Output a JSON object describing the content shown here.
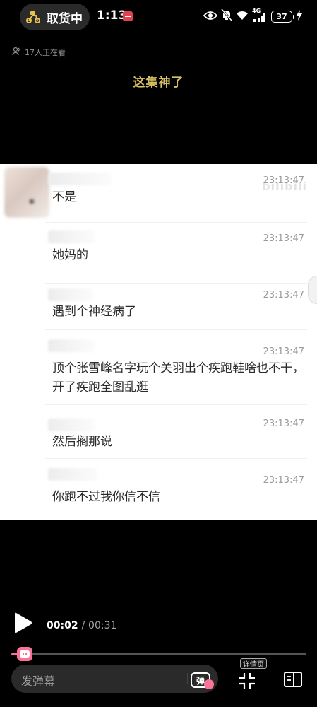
{
  "status_bar": {
    "pickup_label": "取货中",
    "time": "1:13",
    "network": "4G",
    "battery": "37"
  },
  "live": {
    "viewers": "17人正在看"
  },
  "video": {
    "caption": "这集神了",
    "watermark": "bilibili",
    "messages": [
      {
        "time": "23:13:47",
        "text": "不是"
      },
      {
        "time": "23:13:47",
        "text": "她妈的"
      },
      {
        "time": "23:13:47",
        "text": "遇到个神经病了"
      },
      {
        "time": "23:13:47",
        "text": "顶个张雪峰名字玩个关羽出个疾跑鞋啥也不干，开了疾跑全图乱逛"
      },
      {
        "time": "23:13:47",
        "text": "然后搁那说"
      },
      {
        "time": "23:13:47",
        "text": "你跑不过我你信不信"
      }
    ]
  },
  "player": {
    "current_time": "00:02",
    "separator": "/",
    "total_time": "00:31",
    "progress": 0.065,
    "danmaku_placeholder": "发弹幕",
    "danmaku_toggle_label": "弹",
    "detail_label": "详情页",
    "accent_color": "#fb7299"
  },
  "icons": {
    "pickup": "scooter-icon",
    "eye": "eye-icon",
    "mute": "bell-off-icon",
    "wifi": "wifi-icon",
    "signal": "signal-icon",
    "charging": "bolt-icon",
    "viewers": "people-icon",
    "play": "play-icon",
    "shrink": "shrink-icon",
    "panel": "side-panel-icon"
  }
}
